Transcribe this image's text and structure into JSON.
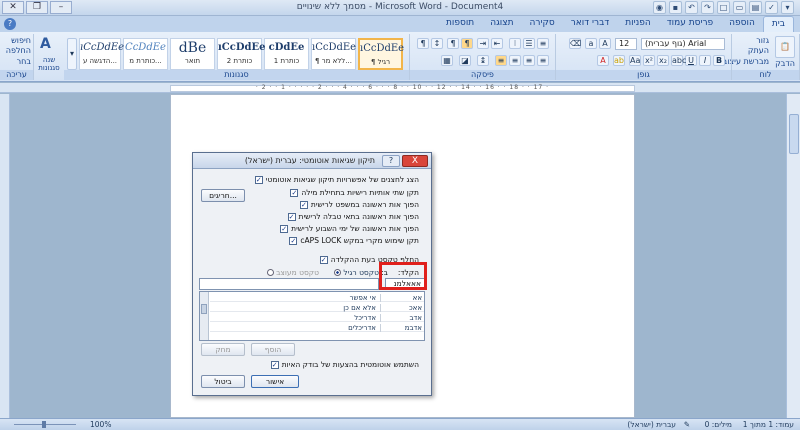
{
  "window": {
    "title": "מסמך ללא שינויים - Microsoft Word - Document4",
    "qat": [
      "save",
      "undo",
      "redo",
      "new",
      "open",
      "print",
      "ab",
      "spell",
      "draw"
    ]
  },
  "tabs": [
    "בית",
    "הוספה",
    "פריסת עמוד",
    "הפניות",
    "דברי דואר",
    "סקירה",
    "תצוגה",
    "תוספות"
  ],
  "ribbon": {
    "clipboard": {
      "label": "לוח",
      "paste": "הדבק",
      "cut": "גזור",
      "copy": "העתק",
      "painter": "מברשת עיצוב"
    },
    "font": {
      "label": "גופן",
      "name": "(גוף עברית) Arial",
      "size": "12"
    },
    "paragraph": {
      "label": "פיסקה"
    },
    "styles": {
      "label": "סגנונות",
      "items": [
        {
          "sample": "ıCcDdEe",
          "name": "¶ רגיל"
        },
        {
          "sample": "ıCcDdEe",
          "name": "¶ ללא מר..."
        },
        {
          "sample": "cDdEe",
          "name": "כותרת 1"
        },
        {
          "sample": "ıCcDdEe",
          "name": "כותרת 2"
        },
        {
          "sample": "dBe",
          "name": "תואר"
        },
        {
          "sample": "CcDdEe",
          "name": "כותרת מ..."
        },
        {
          "sample": "ıCcDdEe",
          "name": "הדגשה ע..."
        }
      ],
      "change": "שנה סגנונות"
    },
    "editing": {
      "label": "עריכה",
      "find": "חיפוש",
      "replace": "החלפה",
      "select": "בחר"
    }
  },
  "ruler": {
    "numbers": "· 2 · · 1 · · · · · 2 · · · 4 · · · 6 · · · 8 · · 10 · · 12 · · 14 · · 16 · · 18 · · 17 ·"
  },
  "dialog": {
    "title": "תיקון שגיאות אוטומטי: עברית (ישראל)",
    "help": "?",
    "close": "X",
    "checks": [
      {
        "text": "הצג לחצנים של אפשרויות תיקון שגיאות אוטומטי",
        "checked": true
      },
      {
        "text": "תקן שתי אותיות רישיות בתחילת מילה",
        "checked": true
      },
      {
        "text": "הפוך אות ראשונה במשפט לרישית",
        "checked": true
      },
      {
        "text": "הפוך אות ראשונה בתאי טבלה לרישית",
        "checked": true
      },
      {
        "text": "הפוך אות ראשונה של ימי השבוע לרישית",
        "checked": true
      },
      {
        "text": "תקן שימוש מקרי במקש cAPS LOCK",
        "checked": true
      }
    ],
    "exceptions": "חריגים...",
    "replace_check": "החלף טקסט בעת ההקלדה",
    "replace_label": "הקלד:",
    "with_label": "ב:",
    "radio_plain": "טקסט רגיל",
    "radio_formatted": "טקסט מעוצב",
    "replace_value": "אאאלמנ",
    "with_value": "",
    "rows": [
      {
        "a": "אא",
        "b": "אי אפשר"
      },
      {
        "a": "אאכ",
        "b": "אלא אם כן"
      },
      {
        "a": "אדב",
        "b": "אדריכל"
      },
      {
        "a": "אדבמ",
        "b": "אדריכלים"
      }
    ],
    "add": "הוסף",
    "delete": "מחק",
    "suggest_check": "השתמש אוטומטית בהצעות של בודק האיות",
    "ok": "אישור",
    "cancel": "ביטול"
  },
  "status": {
    "page": "עמוד: 1 מתוך 1",
    "words": "מילים: 0",
    "language": "עברית (ישראל)",
    "zoom": "100%"
  }
}
